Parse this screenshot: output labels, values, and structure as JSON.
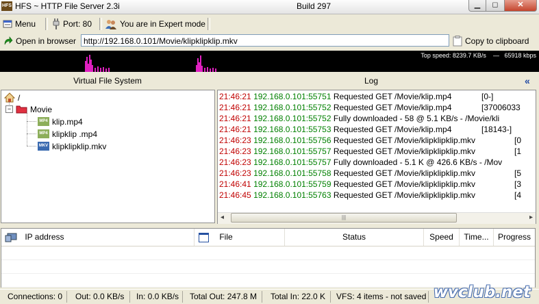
{
  "window": {
    "title": "HFS ~ HTTP File Server 2.3i",
    "build": "Build 297",
    "icon_text": "HFS"
  },
  "toolbar": {
    "menu_label": "Menu",
    "port_label": "Port: 80",
    "mode_label": "You are in Expert mode"
  },
  "urlbar": {
    "open_label": "Open in browser",
    "url": "http://192.168.0.101/Movie/klipklipklip.mkv",
    "copy_label": "Copy to clipboard"
  },
  "graph": {
    "top_speed": "Top speed: 8239.7 KB/s",
    "current_rate": "65918 kbps",
    "bar_color": "#e020c0"
  },
  "vfs": {
    "header": "Virtual File System",
    "root": "/",
    "folder": "Movie",
    "files": [
      {
        "name": "klip.mp4",
        "badge": "MP4"
      },
      {
        "name": "klipklip .mp4",
        "badge": "MP4"
      },
      {
        "name": "klipklipklip.mkv",
        "badge": "MKV"
      }
    ]
  },
  "log": {
    "header": "Log",
    "lines": [
      {
        "time": "21:46:21",
        "ip": "192.168.0.101:55751",
        "msg": "Requested GET /Movie/klip.mp4",
        "extra": "[0-]"
      },
      {
        "time": "21:46:21",
        "ip": "192.168.0.101:55752",
        "msg": "Requested GET /Movie/klip.mp4",
        "extra": "[37006033"
      },
      {
        "time": "21:46:21",
        "ip": "192.168.0.101:55752",
        "msg": "Fully downloaded - 58 @ 5.1 KB/s - /Movie/kli",
        "extra": ""
      },
      {
        "time": "21:46:21",
        "ip": "192.168.0.101:55753",
        "msg": "Requested GET /Movie/klip.mp4",
        "extra": "[18143-]"
      },
      {
        "time": "21:46:23",
        "ip": "192.168.0.101:55756",
        "msg": "Requested GET /Movie/klipklipklip.mkv",
        "extra": "[0"
      },
      {
        "time": "21:46:23",
        "ip": "192.168.0.101:55757",
        "msg": "Requested GET /Movie/klipklipklip.mkv",
        "extra": "[1"
      },
      {
        "time": "21:46:23",
        "ip": "192.168.0.101:55757",
        "msg": "Fully downloaded - 5.1 K @ 426.6 KB/s - /Mov",
        "extra": ""
      },
      {
        "time": "21:46:23",
        "ip": "192.168.0.101:55758",
        "msg": "Requested GET /Movie/klipklipklip.mkv",
        "extra": "[5"
      },
      {
        "time": "21:46:41",
        "ip": "192.168.0.101:55759",
        "msg": "Requested GET /Movie/klipklipklip.mkv",
        "extra": "[3"
      },
      {
        "time": "21:46:45",
        "ip": "192.168.0.101:55763",
        "msg": "Requested GET /Movie/klipklipklip.mkv",
        "extra": "[4"
      }
    ]
  },
  "connections": {
    "columns": {
      "ip": "IP address",
      "file": "File",
      "status": "Status",
      "speed": "Speed",
      "time": "Time...",
      "progress": "Progress"
    }
  },
  "statusbar": {
    "connections": "Connections: 0",
    "out": "Out: 0.0 KB/s",
    "in": "In: 0.0 KB/s",
    "total_out": "Total Out: 247.8 M",
    "total_in": "Total In: 22.0 K",
    "vfs": "VFS: 4 items - not saved"
  },
  "watermark": "wvclub.net"
}
